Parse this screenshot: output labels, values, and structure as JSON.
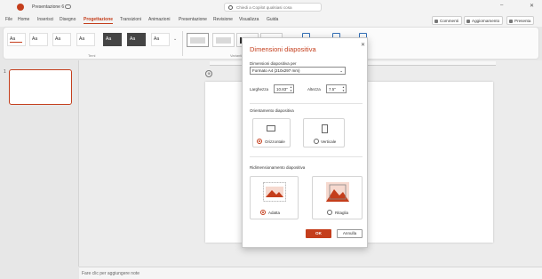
{
  "titlebar": {
    "doc_title": "Presentazione 6",
    "search_placeholder": "Chiedi a Copilot qualsiasi cosa",
    "minimize": "–",
    "close": "✕"
  },
  "menu": {
    "tabs": [
      "File",
      "Home",
      "Inserisci",
      "Disegno",
      "Progettazione",
      "Transizioni",
      "Animazioni",
      "Presentazione",
      "Revisione",
      "Visualizza",
      "Guida"
    ],
    "active": "Progettazione",
    "comments": "Commenti",
    "catchup": "Aggiornamento",
    "present": "Presenta"
  },
  "ribbon": {
    "themes": [
      "Aa",
      "Aa",
      "Aa",
      "Aa",
      "Aa",
      "Aa",
      "Aa",
      "Aa",
      "Aa"
    ],
    "group_themes": "Temi",
    "group_variants": "Varianti"
  },
  "slides_panel": {
    "slide_number": "1"
  },
  "canvas": {
    "layout_icon": "⊕"
  },
  "notes": {
    "placeholder": "Fare clic per aggiungere note"
  },
  "dialog": {
    "title": "Dimensioni diapositiva",
    "size_label": "Dimensioni diapositiva per",
    "size_value": "Formato A4 (210x297 mm)",
    "width_label": "Larghezza",
    "width_value": "10.83\"",
    "height_label": "Altezza",
    "height_value": "7.5\"",
    "orientation_label": "Orientamento diapositiva",
    "landscape": "Orizzontale",
    "portrait": "Verticale",
    "scaling_label": "Ridimensionamento diapositiva",
    "fit": "Adatta",
    "maximize": "Ritaglia",
    "ok": "OK",
    "cancel": "Annulla"
  }
}
